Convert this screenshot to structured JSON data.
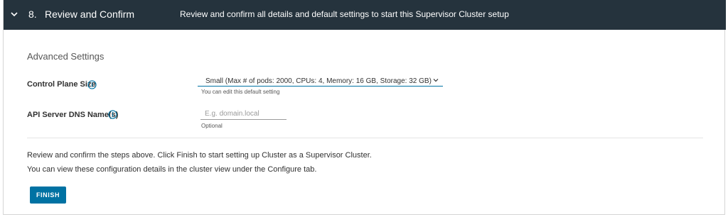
{
  "step": {
    "number": "8.",
    "title": "Review and Confirm",
    "description": "Review and confirm all details and default settings to start this Supervisor Cluster setup"
  },
  "advanced": {
    "section_title": "Advanced Settings",
    "control_plane": {
      "label": "Control Plane Size",
      "value": "Small (Max # of pods: 2000, CPUs: 4, Memory: 16 GB, Storage: 32 GB)",
      "helper": "You can edit this default setting"
    },
    "dns": {
      "label": "API Server DNS Name(s)",
      "placeholder": "E.g. domain.local",
      "value": "",
      "helper": "Optional"
    }
  },
  "review": {
    "line1": "Review and confirm the steps above. Click Finish to start setting up Cluster as a Supervisor Cluster.",
    "line2": "You can view these configuration details in the cluster view under the Configure tab."
  },
  "finish_label": "FINISH",
  "colors": {
    "header_bg": "#25333d",
    "accent": "#0072a3"
  },
  "icons": {
    "collapse": "chevron-down-icon",
    "info": "info-circle-icon",
    "select_caret": "caret-down-icon"
  }
}
